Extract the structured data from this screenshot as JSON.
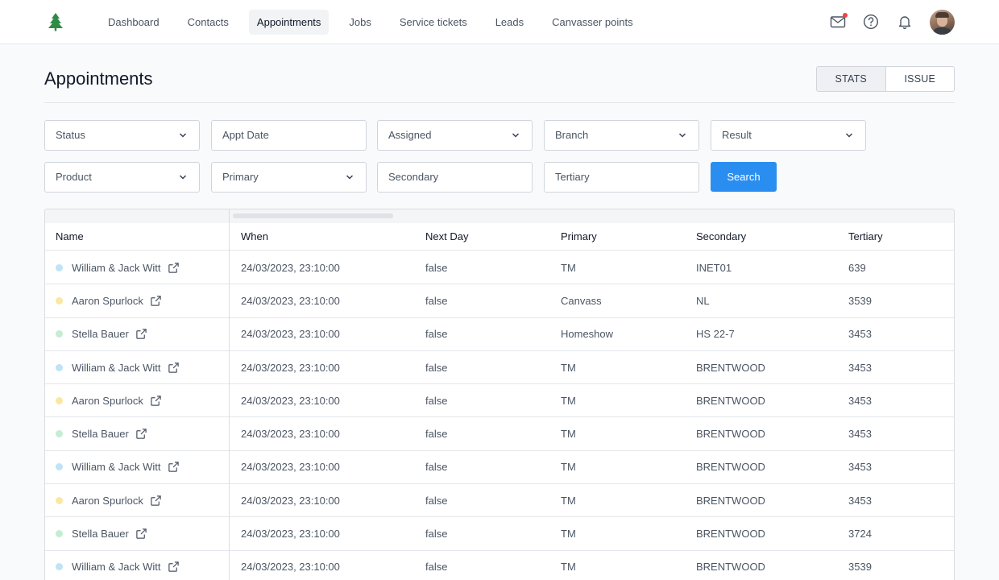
{
  "nav": {
    "items": [
      {
        "label": "Dashboard",
        "name": "nav-dashboard",
        "active": false
      },
      {
        "label": "Contacts",
        "name": "nav-contacts",
        "active": false
      },
      {
        "label": "Appointments",
        "name": "nav-appointments",
        "active": true
      },
      {
        "label": "Jobs",
        "name": "nav-jobs",
        "active": false
      },
      {
        "label": "Service tickets",
        "name": "nav-service-tickets",
        "active": false
      },
      {
        "label": "Leads",
        "name": "nav-leads",
        "active": false
      },
      {
        "label": "Canvasser points",
        "name": "nav-canvasser-points",
        "active": false
      }
    ]
  },
  "header": {
    "title": "Appointments",
    "tabs": [
      "STATS",
      "ISSUE"
    ]
  },
  "filters": {
    "status": "Status",
    "appt_date": "Appt Date",
    "assigned": "Assigned",
    "branch": "Branch",
    "result": "Result",
    "product": "Product",
    "primary": "Primary",
    "secondary": "Secondary",
    "tertiary": "Tertiary",
    "search_label": "Search"
  },
  "colors": {
    "accent": "#2a8ef0",
    "status_blue": "#bfe3f7",
    "status_yellow": "#fbe7a1",
    "status_green": "#c6ecd3"
  },
  "table": {
    "columns": [
      "Name",
      "When",
      "Next Day",
      "Primary",
      "Secondary",
      "Tertiary"
    ],
    "rows": [
      {
        "status": "blue",
        "name": "William & Jack Witt",
        "when": "24/03/2023, 23:10:00",
        "next_day": "false",
        "primary": "TM",
        "secondary": "INET01",
        "tertiary": "639"
      },
      {
        "status": "yellow",
        "name": "Aaron Spurlock",
        "when": "24/03/2023, 23:10:00",
        "next_day": "false",
        "primary": "Canvass",
        "secondary": "NL",
        "tertiary": "3539"
      },
      {
        "status": "green",
        "name": "Stella Bauer",
        "when": "24/03/2023, 23:10:00",
        "next_day": "false",
        "primary": "Homeshow",
        "secondary": "HS 22-7",
        "tertiary": "3453"
      },
      {
        "status": "blue",
        "name": "William & Jack Witt",
        "when": "24/03/2023, 23:10:00",
        "next_day": "false",
        "primary": "TM",
        "secondary": "BRENTWOOD",
        "tertiary": "3453"
      },
      {
        "status": "yellow",
        "name": "Aaron Spurlock",
        "when": "24/03/2023, 23:10:00",
        "next_day": "false",
        "primary": "TM",
        "secondary": "BRENTWOOD",
        "tertiary": "3453"
      },
      {
        "status": "green",
        "name": "Stella Bauer",
        "when": "24/03/2023, 23:10:00",
        "next_day": "false",
        "primary": "TM",
        "secondary": "BRENTWOOD",
        "tertiary": "3453"
      },
      {
        "status": "blue",
        "name": "William & Jack Witt",
        "when": "24/03/2023, 23:10:00",
        "next_day": "false",
        "primary": "TM",
        "secondary": "BRENTWOOD",
        "tertiary": "3453"
      },
      {
        "status": "yellow",
        "name": "Aaron Spurlock",
        "when": "24/03/2023, 23:10:00",
        "next_day": "false",
        "primary": "TM",
        "secondary": "BRENTWOOD",
        "tertiary": "3453"
      },
      {
        "status": "green",
        "name": "Stella Bauer",
        "when": "24/03/2023, 23:10:00",
        "next_day": "false",
        "primary": "TM",
        "secondary": "BRENTWOOD",
        "tertiary": "3724"
      },
      {
        "status": "blue",
        "name": "William & Jack Witt",
        "when": "24/03/2023, 23:10:00",
        "next_day": "false",
        "primary": "TM",
        "secondary": "BRENTWOOD",
        "tertiary": "3539"
      }
    ]
  }
}
